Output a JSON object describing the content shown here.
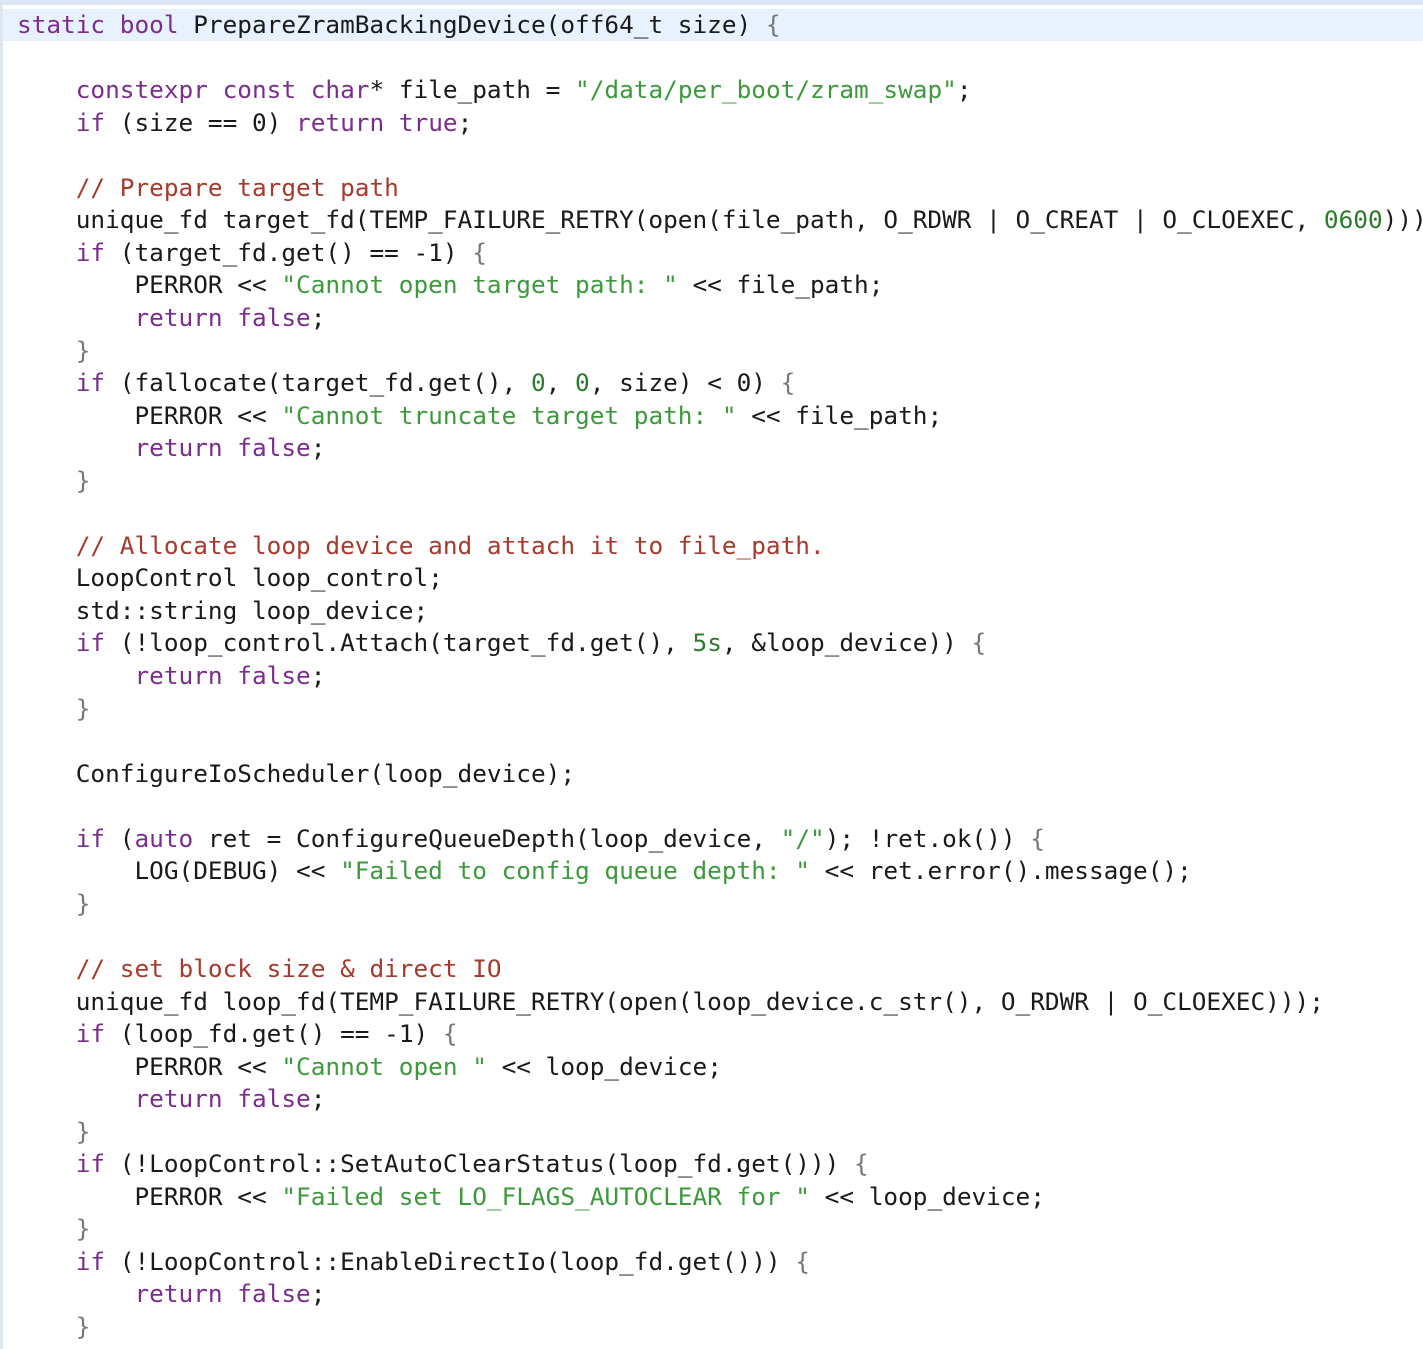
{
  "code": {
    "language": "cpp",
    "lines": [
      [
        {
          "t": "static bool ",
          "c": "kw"
        },
        {
          "t": "PrepareZramBackingDevice(off64_t size) ",
          "c": ""
        },
        {
          "t": "{",
          "c": "brace"
        }
      ],
      [],
      [
        {
          "t": "    ",
          "c": ""
        },
        {
          "t": "constexpr const char",
          "c": "kw"
        },
        {
          "t": "* file_path = ",
          "c": ""
        },
        {
          "t": "\"/data/per_boot/zram_swap\"",
          "c": "str"
        },
        {
          "t": ";",
          "c": ""
        }
      ],
      [
        {
          "t": "    ",
          "c": ""
        },
        {
          "t": "if",
          "c": "kw"
        },
        {
          "t": " (size == 0) ",
          "c": ""
        },
        {
          "t": "return true",
          "c": "kw"
        },
        {
          "t": ";",
          "c": ""
        }
      ],
      [],
      [
        {
          "t": "    ",
          "c": ""
        },
        {
          "t": "// Prepare target path",
          "c": "cmt"
        }
      ],
      [
        {
          "t": "    unique_fd target_fd(TEMP_FAILURE_RETRY(open(file_path, O_RDWR | O_CREAT | O_CLOEXEC, ",
          "c": ""
        },
        {
          "t": "0600",
          "c": "num"
        },
        {
          "t": ")));",
          "c": ""
        }
      ],
      [
        {
          "t": "    ",
          "c": ""
        },
        {
          "t": "if",
          "c": "kw"
        },
        {
          "t": " (target_fd.get() == -1) ",
          "c": ""
        },
        {
          "t": "{",
          "c": "brace"
        }
      ],
      [
        {
          "t": "        PERROR << ",
          "c": ""
        },
        {
          "t": "\"Cannot open target path: \"",
          "c": "str"
        },
        {
          "t": " << file_path;",
          "c": ""
        }
      ],
      [
        {
          "t": "        ",
          "c": ""
        },
        {
          "t": "return false",
          "c": "kw"
        },
        {
          "t": ";",
          "c": ""
        }
      ],
      [
        {
          "t": "    ",
          "c": ""
        },
        {
          "t": "}",
          "c": "brace"
        }
      ],
      [
        {
          "t": "    ",
          "c": ""
        },
        {
          "t": "if",
          "c": "kw"
        },
        {
          "t": " (fallocate(target_fd.get(), ",
          "c": ""
        },
        {
          "t": "0",
          "c": "num"
        },
        {
          "t": ", ",
          "c": ""
        },
        {
          "t": "0",
          "c": "num"
        },
        {
          "t": ", size) < 0) ",
          "c": ""
        },
        {
          "t": "{",
          "c": "brace"
        }
      ],
      [
        {
          "t": "        PERROR << ",
          "c": ""
        },
        {
          "t": "\"Cannot truncate target path: \"",
          "c": "str"
        },
        {
          "t": " << file_path;",
          "c": ""
        }
      ],
      [
        {
          "t": "        ",
          "c": ""
        },
        {
          "t": "return false",
          "c": "kw"
        },
        {
          "t": ";",
          "c": ""
        }
      ],
      [
        {
          "t": "    ",
          "c": ""
        },
        {
          "t": "}",
          "c": "brace"
        }
      ],
      [],
      [
        {
          "t": "    ",
          "c": ""
        },
        {
          "t": "// Allocate loop device and attach it to file_path.",
          "c": "cmt"
        }
      ],
      [
        {
          "t": "    LoopControl loop_control;",
          "c": ""
        }
      ],
      [
        {
          "t": "    std::string loop_device;",
          "c": ""
        }
      ],
      [
        {
          "t": "    ",
          "c": ""
        },
        {
          "t": "if",
          "c": "kw"
        },
        {
          "t": " (!loop_control.Attach(target_fd.get(), ",
          "c": ""
        },
        {
          "t": "5s",
          "c": "num"
        },
        {
          "t": ", &loop_device)) ",
          "c": ""
        },
        {
          "t": "{",
          "c": "brace"
        }
      ],
      [
        {
          "t": "        ",
          "c": ""
        },
        {
          "t": "return false",
          "c": "kw"
        },
        {
          "t": ";",
          "c": ""
        }
      ],
      [
        {
          "t": "    ",
          "c": ""
        },
        {
          "t": "}",
          "c": "brace"
        }
      ],
      [],
      [
        {
          "t": "    ConfigureIoScheduler(loop_device);",
          "c": ""
        }
      ],
      [],
      [
        {
          "t": "    ",
          "c": ""
        },
        {
          "t": "if",
          "c": "kw"
        },
        {
          "t": " (",
          "c": ""
        },
        {
          "t": "auto",
          "c": "kw"
        },
        {
          "t": " ret = ConfigureQueueDepth(loop_device, ",
          "c": ""
        },
        {
          "t": "\"/\"",
          "c": "str"
        },
        {
          "t": "); !ret.ok()) ",
          "c": ""
        },
        {
          "t": "{",
          "c": "brace"
        }
      ],
      [
        {
          "t": "        LOG(DEBUG) << ",
          "c": ""
        },
        {
          "t": "\"Failed to config queue depth: \"",
          "c": "str"
        },
        {
          "t": " << ret.error().message();",
          "c": ""
        }
      ],
      [
        {
          "t": "    ",
          "c": ""
        },
        {
          "t": "}",
          "c": "brace"
        }
      ],
      [],
      [
        {
          "t": "    ",
          "c": ""
        },
        {
          "t": "// set block size & direct IO",
          "c": "cmt"
        }
      ],
      [
        {
          "t": "    unique_fd loop_fd(TEMP_FAILURE_RETRY(open(loop_device.c_str(), O_RDWR | O_CLOEXEC)));",
          "c": ""
        }
      ],
      [
        {
          "t": "    ",
          "c": ""
        },
        {
          "t": "if",
          "c": "kw"
        },
        {
          "t": " (loop_fd.get() == -1) ",
          "c": ""
        },
        {
          "t": "{",
          "c": "brace"
        }
      ],
      [
        {
          "t": "        PERROR << ",
          "c": ""
        },
        {
          "t": "\"Cannot open \"",
          "c": "str"
        },
        {
          "t": " << loop_device;",
          "c": ""
        }
      ],
      [
        {
          "t": "        ",
          "c": ""
        },
        {
          "t": "return false",
          "c": "kw"
        },
        {
          "t": ";",
          "c": ""
        }
      ],
      [
        {
          "t": "    ",
          "c": ""
        },
        {
          "t": "}",
          "c": "brace"
        }
      ],
      [
        {
          "t": "    ",
          "c": ""
        },
        {
          "t": "if",
          "c": "kw"
        },
        {
          "t": " (!LoopControl::SetAutoClearStatus(loop_fd.get())) ",
          "c": ""
        },
        {
          "t": "{",
          "c": "brace"
        }
      ],
      [
        {
          "t": "        PERROR << ",
          "c": ""
        },
        {
          "t": "\"Failed set LO_FLAGS_AUTOCLEAR for \"",
          "c": "str"
        },
        {
          "t": " << loop_device;",
          "c": ""
        }
      ],
      [
        {
          "t": "    ",
          "c": ""
        },
        {
          "t": "}",
          "c": "brace"
        }
      ],
      [
        {
          "t": "    ",
          "c": ""
        },
        {
          "t": "if",
          "c": "kw"
        },
        {
          "t": " (!LoopControl::EnableDirectIo(loop_fd.get())) ",
          "c": ""
        },
        {
          "t": "{",
          "c": "brace"
        }
      ],
      [
        {
          "t": "        ",
          "c": ""
        },
        {
          "t": "return false",
          "c": "kw"
        },
        {
          "t": ";",
          "c": ""
        }
      ],
      [
        {
          "t": "    ",
          "c": ""
        },
        {
          "t": "}",
          "c": "brace"
        }
      ]
    ]
  }
}
